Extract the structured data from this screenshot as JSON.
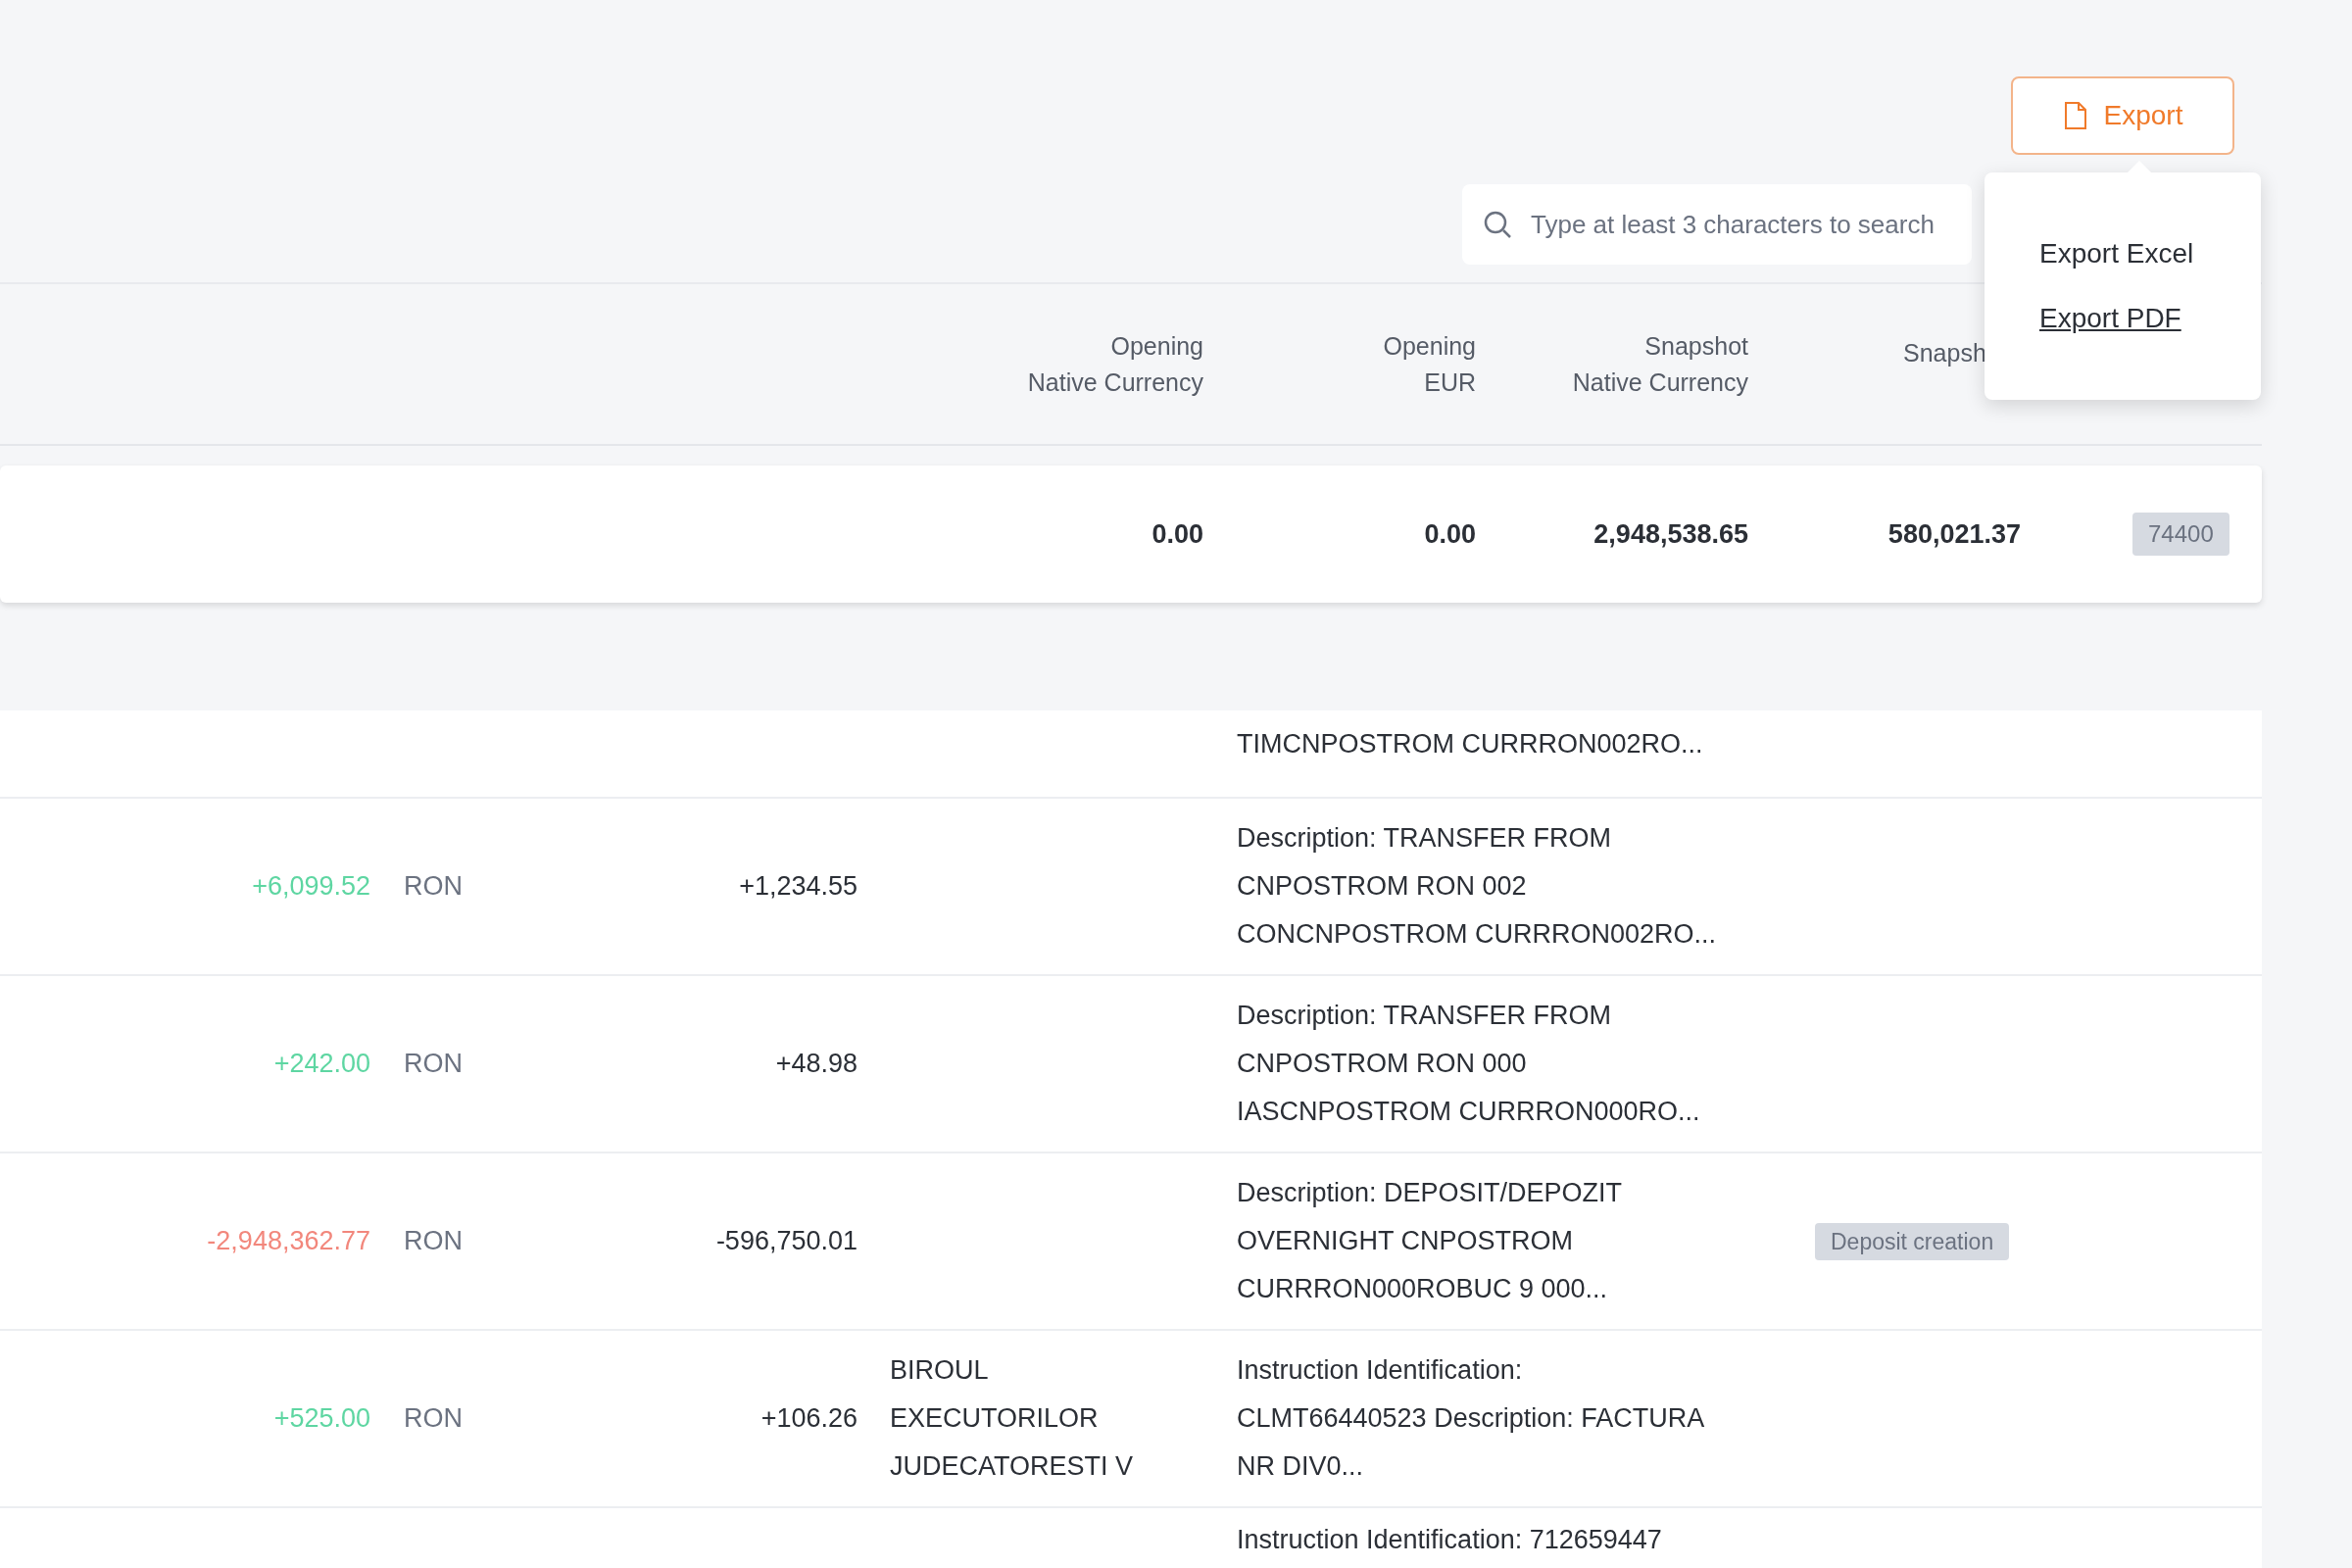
{
  "toolbar": {
    "export_button": "Export",
    "search": {
      "placeholder": "Type at least 3 characters to search"
    }
  },
  "export_menu": {
    "items": [
      {
        "label": "Export Excel",
        "hovered": false
      },
      {
        "label": "Export PDF",
        "hovered": true
      }
    ]
  },
  "table": {
    "columns": [
      {
        "lines": [
          "Opening",
          "Native Currency"
        ]
      },
      {
        "lines": [
          "Opening",
          "EUR"
        ]
      },
      {
        "lines": [
          "Snapshot",
          "Native Currency"
        ]
      },
      {
        "lines": [
          "Snapsh"
        ]
      }
    ],
    "summary": {
      "values": [
        "0.00",
        "0.00",
        "2,948,538.65",
        "580,021.37"
      ],
      "count": "74400"
    },
    "rows": [
      {
        "amount": "",
        "currency": "",
        "amount_eur": "",
        "counterparty": [],
        "description": [
          "TIMCNPOSTROM CURRRON002RO..."
        ]
      },
      {
        "amount": "+6,099.52",
        "kind": "credit",
        "currency": "RON",
        "amount_eur": "+1,234.55",
        "counterparty": [],
        "description": [
          "Description: TRANSFER FROM",
          "CNPOSTROM RON 002",
          "CONCNPOSTROM CURRRON002RO..."
        ]
      },
      {
        "amount": "+242.00",
        "kind": "credit",
        "currency": "RON",
        "amount_eur": "+48.98",
        "counterparty": [],
        "description": [
          "Description: TRANSFER FROM",
          "CNPOSTROM RON 000",
          "IASCNPOSTROM CURRRON000RO..."
        ]
      },
      {
        "amount": "-2,948,362.77",
        "kind": "debit",
        "currency": "RON",
        "amount_eur": "-596,750.01",
        "counterparty": [],
        "description": [
          "Description: DEPOSIT/DEPOZIT",
          "OVERNIGHT CNPOSTROM",
          "CURRRON000ROBUC 9 000..."
        ],
        "tag": "Deposit creation"
      },
      {
        "amount": "+525.00",
        "kind": "credit",
        "currency": "RON",
        "amount_eur": "+106.26",
        "counterparty": [
          "BIROUL",
          "EXECUTORILOR",
          "JUDECATORESTI V"
        ],
        "description": [
          "Instruction Identification:",
          "CLMT66440523 Description: FACTURA",
          "NR DIV0..."
        ]
      },
      {
        "amount": "",
        "currency": "",
        "amount_eur": "",
        "counterparty": [],
        "description": [
          "Instruction Identification: 712659447"
        ]
      }
    ]
  }
}
